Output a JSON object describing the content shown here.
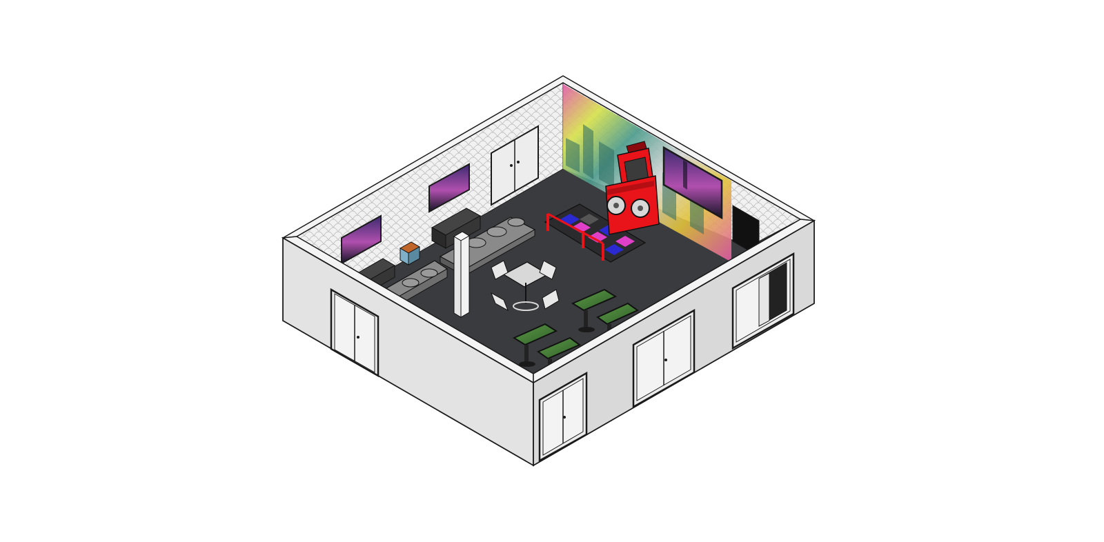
{
  "scene": {
    "type": "isometric-room-render",
    "subject": "game-lounge",
    "colors": {
      "background": "#ffffff",
      "floor": "#3a3b3e",
      "exterior_wall": "#e3e3e3",
      "exterior_wall_side": "#d2d2d2",
      "wall_top": "#f4f4f4",
      "interior_wall": "#efefef",
      "outline": "#1b1b1b",
      "arcade_red": "#e8141a",
      "neon_pink": "#e040c8",
      "dance_blue": "#2a2ad0",
      "sofa": "#6d6d6d",
      "grass_screen": "#4d8a3a"
    },
    "objects": [
      {
        "name": "dance-arcade-machine",
        "icon": "arcade-icon"
      },
      {
        "name": "dance-floor-pads",
        "icon": "dance-pad-icon"
      },
      {
        "name": "sofa",
        "icon": "sofa-icon",
        "count": 2
      },
      {
        "name": "tv-screen",
        "icon": "tv-icon",
        "count": 3
      },
      {
        "name": "table-with-chairs",
        "icon": "table-icon"
      },
      {
        "name": "touch-table-game",
        "icon": "gaming-table-icon",
        "count": 4
      },
      {
        "name": "double-door",
        "icon": "door-icon",
        "count": 5
      },
      {
        "name": "support-column",
        "icon": "column-icon"
      },
      {
        "name": "aquarium-cabinet",
        "icon": "cabinet-icon"
      },
      {
        "name": "graffiti-mural",
        "icon": "mural-icon"
      }
    ]
  }
}
